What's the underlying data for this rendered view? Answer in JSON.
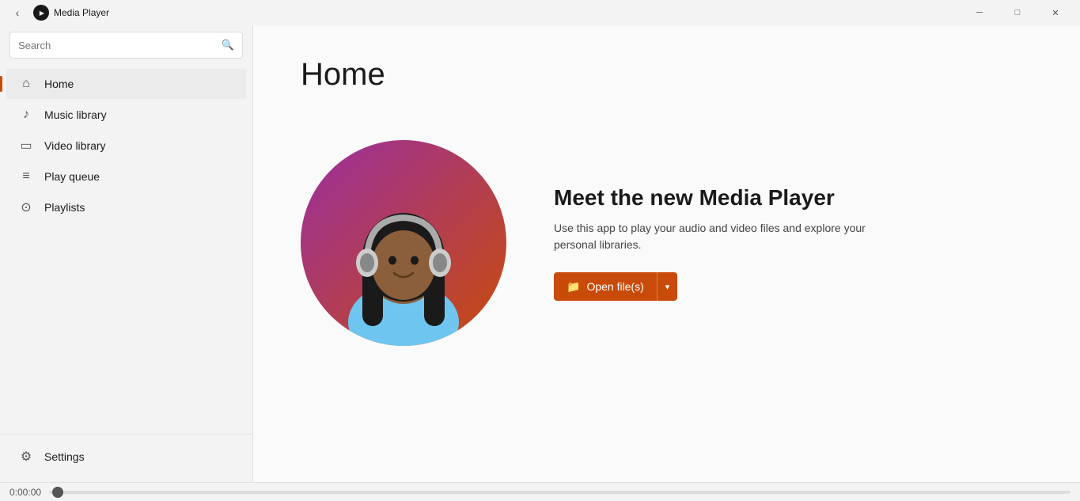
{
  "titlebar": {
    "title": "Media Player",
    "back_label": "‹",
    "minimize_label": "─",
    "maximize_label": "□",
    "close_label": "✕"
  },
  "sidebar": {
    "search_placeholder": "Search",
    "nav_items": [
      {
        "id": "home",
        "label": "Home",
        "icon": "home",
        "active": true
      },
      {
        "id": "music-library",
        "label": "Music library",
        "icon": "music",
        "active": false
      },
      {
        "id": "video-library",
        "label": "Video library",
        "icon": "video",
        "active": false
      },
      {
        "id": "play-queue",
        "label": "Play queue",
        "icon": "queue",
        "active": false
      },
      {
        "id": "playlists",
        "label": "Playlists",
        "icon": "playlist",
        "active": false
      }
    ],
    "settings_label": "Settings"
  },
  "main": {
    "page_title": "Home",
    "hero_heading": "Meet the new Media Player",
    "hero_subtext": "Use this app to play your audio and video files and explore your personal libraries.",
    "open_files_label": "Open file(s)"
  },
  "progressbar": {
    "time": "0:00:00"
  }
}
